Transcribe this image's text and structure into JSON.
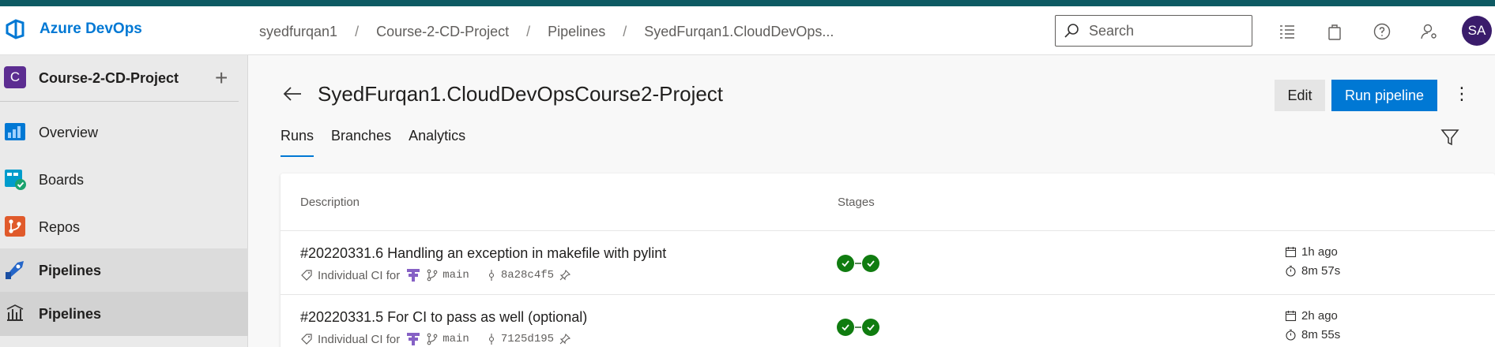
{
  "app": {
    "name": "Azure DevOps"
  },
  "breadcrumb": [
    "syedfurqan1",
    "Course-2-CD-Project",
    "Pipelines",
    "SyedFurqan1.CloudDevOps..."
  ],
  "search": {
    "placeholder": "Search"
  },
  "user": {
    "initials": "SA"
  },
  "project": {
    "initial": "C",
    "name": "Course-2-CD-Project"
  },
  "sidebar": {
    "items": [
      {
        "label": "Overview"
      },
      {
        "label": "Boards"
      },
      {
        "label": "Repos"
      },
      {
        "label": "Pipelines"
      },
      {
        "label": "Pipelines"
      }
    ]
  },
  "page": {
    "title": "SyedFurqan1.CloudDevOpsCourse2-Project",
    "edit_label": "Edit",
    "run_label": "Run pipeline",
    "tabs": [
      "Runs",
      "Branches",
      "Analytics"
    ]
  },
  "table": {
    "headers": {
      "description": "Description",
      "stages": "Stages"
    },
    "rows": [
      {
        "title": "#20220331.6 Handling an exception in makefile with pylint",
        "trigger": "Individual CI for",
        "branch": "main",
        "commit": "8a28c4f5",
        "ago": "1h ago",
        "duration": "8m 57s"
      },
      {
        "title": "#20220331.5 For CI to pass as well (optional)",
        "trigger": "Individual CI for",
        "branch": "main",
        "commit": "7125d195",
        "ago": "2h ago",
        "duration": "8m 55s"
      }
    ]
  },
  "colors": {
    "accent": "#0078d4",
    "success": "#107c10",
    "project": "#5c2d91",
    "avatar": "#3a1c6b"
  }
}
